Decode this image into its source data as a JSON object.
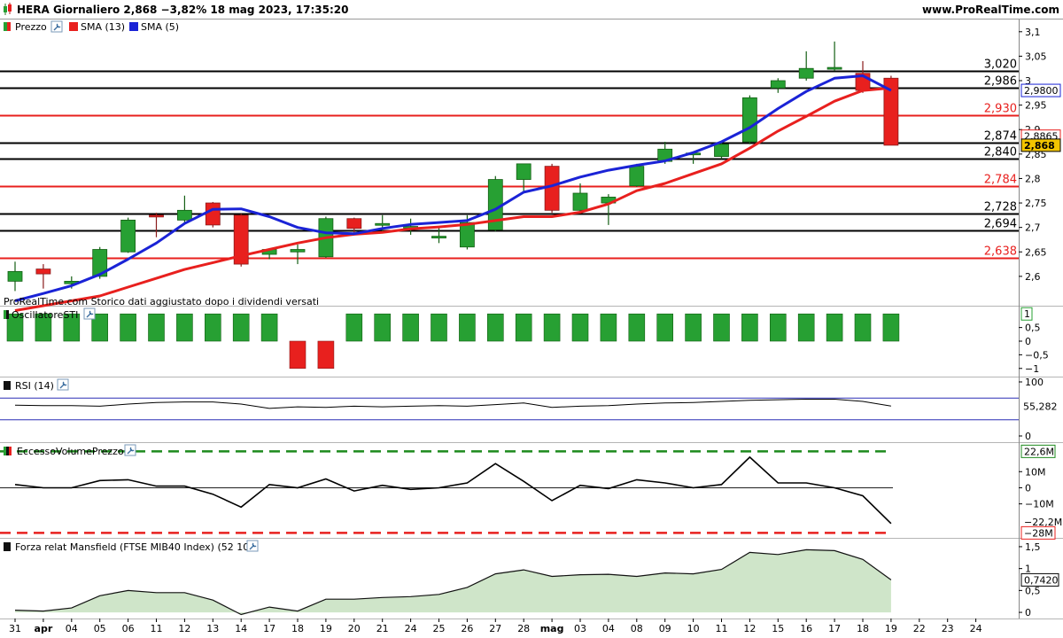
{
  "header": {
    "title": "HERA Giornaliero 2,868 −3,82% 18 mag 2023, 17:35:20",
    "site": "www.ProRealTime.com"
  },
  "note": "ProRealTime.com  Storico dati aggiustato dopo i dividendi versati",
  "colors": {
    "up": "#27a033",
    "down": "#e8201e",
    "sma13": "#e8201e",
    "sma5": "#1a23d6",
    "level_black": "#000000",
    "level_red": "#e8201e",
    "current_badge": "#f2c500",
    "volume_dash_up": "#1d8a1d",
    "volume_dash_down": "#e8201e",
    "mansfield_fill": "#cfe5c9"
  },
  "chart_data": [
    {
      "type": "candlestick",
      "name": "price",
      "legend": [
        {
          "name": "Prezzo",
          "color": "#27a033",
          "icon": "candle-icon"
        },
        {
          "name": "SMA (13)",
          "color": "#e8201e"
        },
        {
          "name": "SMA (5)",
          "color": "#1a23d6"
        }
      ],
      "ylim": [
        2.54,
        3.125
      ],
      "y_ticks": [
        "2,6",
        "2,65",
        "2,7",
        "2,75",
        "2,8",
        "2,85",
        "2,9",
        "2,95",
        "3",
        "3,05",
        "3,1"
      ],
      "y_tick_values": [
        2.6,
        2.65,
        2.7,
        2.75,
        2.8,
        2.85,
        2.9,
        2.95,
        3.0,
        3.05,
        3.1
      ],
      "x_labels": [
        "31",
        "apr",
        "04",
        "05",
        "06",
        "11",
        "12",
        "13",
        "14",
        "17",
        "18",
        "19",
        "20",
        "21",
        "24",
        "25",
        "26",
        "27",
        "28",
        "mag",
        "03",
        "04",
        "08",
        "09",
        "10",
        "11",
        "12",
        "15",
        "16",
        "17",
        "18",
        "19",
        "22",
        "23",
        "24"
      ],
      "bold_x_labels": [
        "apr",
        "mag"
      ],
      "candles": [
        {
          "o": 2.59,
          "h": 2.63,
          "l": 2.57,
          "c": 2.61
        },
        {
          "o": 2.615,
          "h": 2.625,
          "l": 2.575,
          "c": 2.605
        },
        {
          "o": 2.585,
          "h": 2.6,
          "l": 2.575,
          "c": 2.59
        },
        {
          "o": 2.6,
          "h": 2.66,
          "l": 2.595,
          "c": 2.655
        },
        {
          "o": 2.65,
          "h": 2.72,
          "l": 2.648,
          "c": 2.715
        },
        {
          "o": 2.725,
          "h": 2.73,
          "l": 2.68,
          "c": 2.722
        },
        {
          "o": 2.715,
          "h": 2.765,
          "l": 2.71,
          "c": 2.735
        },
        {
          "o": 2.75,
          "h": 2.752,
          "l": 2.7,
          "c": 2.705
        },
        {
          "o": 2.725,
          "h": 2.728,
          "l": 2.62,
          "c": 2.625
        },
        {
          "o": 2.645,
          "h": 2.655,
          "l": 2.635,
          "c": 2.655
        },
        {
          "o": 2.65,
          "h": 2.665,
          "l": 2.625,
          "c": 2.655
        },
        {
          "o": 2.64,
          "h": 2.722,
          "l": 2.638,
          "c": 2.718
        },
        {
          "o": 2.718,
          "h": 2.72,
          "l": 2.685,
          "c": 2.698
        },
        {
          "o": 2.705,
          "h": 2.725,
          "l": 2.69,
          "c": 2.708
        },
        {
          "o": 2.7,
          "h": 2.718,
          "l": 2.685,
          "c": 2.702
        },
        {
          "o": 2.68,
          "h": 2.7,
          "l": 2.668,
          "c": 2.682
        },
        {
          "o": 2.66,
          "h": 2.725,
          "l": 2.655,
          "c": 2.71
        },
        {
          "o": 2.695,
          "h": 2.805,
          "l": 2.692,
          "c": 2.798
        },
        {
          "o": 2.798,
          "h": 2.83,
          "l": 2.77,
          "c": 2.83
        },
        {
          "o": 2.825,
          "h": 2.83,
          "l": 2.73,
          "c": 2.735
        },
        {
          "o": 2.735,
          "h": 2.79,
          "l": 2.73,
          "c": 2.77
        },
        {
          "o": 2.75,
          "h": 2.768,
          "l": 2.705,
          "c": 2.762
        },
        {
          "o": 2.785,
          "h": 2.83,
          "l": 2.783,
          "c": 2.825
        },
        {
          "o": 2.835,
          "h": 2.875,
          "l": 2.83,
          "c": 2.86
        },
        {
          "o": 2.85,
          "h": 2.855,
          "l": 2.83,
          "c": 2.852
        },
        {
          "o": 2.845,
          "h": 2.875,
          "l": 2.84,
          "c": 2.87
        },
        {
          "o": 2.875,
          "h": 2.97,
          "l": 2.87,
          "c": 2.965
        },
        {
          "o": 2.985,
          "h": 3.005,
          "l": 2.975,
          "c": 3.0
        },
        {
          "o": 3.005,
          "h": 3.06,
          "l": 3.0,
          "c": 3.025
        },
        {
          "o": 3.025,
          "h": 3.08,
          "l": 3.02,
          "c": 3.027
        },
        {
          "o": 3.015,
          "h": 3.04,
          "l": 2.975,
          "c": 2.98
        },
        {
          "o": 3.005,
          "h": 3.01,
          "l": 2.868,
          "c": 2.868
        }
      ],
      "sma13": [
        2.53,
        2.54,
        2.55,
        2.56,
        2.578,
        2.596,
        2.614,
        2.628,
        2.642,
        2.655,
        2.668,
        2.679,
        2.686,
        2.69,
        2.697,
        2.701,
        2.706,
        2.714,
        2.722,
        2.722,
        2.731,
        2.748,
        2.775,
        2.79,
        2.81,
        2.83,
        2.862,
        2.897,
        2.927,
        2.958,
        2.98,
        2.985
      ],
      "sma5": [
        2.55,
        2.565,
        2.581,
        2.604,
        2.635,
        2.668,
        2.708,
        2.737,
        2.738,
        2.722,
        2.7,
        2.689,
        2.687,
        2.698,
        2.706,
        2.71,
        2.714,
        2.737,
        2.772,
        2.785,
        2.803,
        2.817,
        2.827,
        2.836,
        2.853,
        2.875,
        2.904,
        2.943,
        2.978,
        3.005,
        3.01,
        2.98
      ],
      "levels": [
        {
          "value": 3.02,
          "label": "3,020",
          "color": "#000000"
        },
        {
          "value": 2.986,
          "label": "2,986",
          "color": "#000000"
        },
        {
          "value": 2.93,
          "label": "2,930",
          "color": "#e8201e"
        },
        {
          "value": 2.874,
          "label": "2,874",
          "color": "#000000"
        },
        {
          "value": 2.84,
          "label": "2,840",
          "color": "#000000"
        },
        {
          "value": 2.784,
          "label": "2,784",
          "color": "#e8201e"
        },
        {
          "value": 2.728,
          "label": "2,728",
          "color": "#000000"
        },
        {
          "value": 2.694,
          "label": "2,694",
          "color": "#000000"
        },
        {
          "value": 2.638,
          "label": "2,638",
          "color": "#e8201e"
        }
      ],
      "badges": [
        {
          "value": 2.98,
          "label": "2,9800",
          "style": "outline-blue"
        },
        {
          "value": 2.8865,
          "label": "2,8865",
          "style": "outline-red"
        },
        {
          "value": 2.868,
          "label": "2,868",
          "style": "fill-yellow"
        }
      ]
    },
    {
      "type": "bar",
      "name": "OscillatoreSTI",
      "legend": "OscillatoreSTI",
      "ylim": [
        -1.3,
        1.3
      ],
      "y_ticks": [
        "1",
        "0,5",
        "0",
        "−0,5",
        "−1"
      ],
      "y_tick_values": [
        1,
        0.5,
        0,
        -0.5,
        -1
      ],
      "values": [
        1,
        1,
        1,
        1,
        1,
        1,
        1,
        1,
        1,
        1,
        -1,
        -1,
        1,
        1,
        1,
        1,
        1,
        1,
        1,
        1,
        1,
        1,
        1,
        1,
        1,
        1,
        1,
        1,
        1,
        1,
        1,
        1
      ],
      "badge": "1"
    },
    {
      "type": "line",
      "name": "RSI (14)",
      "legend": "RSI (14)",
      "ylim": [
        0,
        100
      ],
      "y_ticks": [
        "100",
        "0"
      ],
      "y_tick_values": [
        100,
        0
      ],
      "bands": [
        70,
        30
      ],
      "values": [
        57,
        56,
        56,
        55,
        59,
        62,
        63,
        63,
        59,
        51,
        54,
        53,
        55,
        54,
        55,
        56,
        55,
        58,
        61,
        53,
        55,
        56,
        59,
        61,
        62,
        64,
        66,
        67,
        68,
        68,
        64,
        55.282
      ],
      "badge": "55,282"
    },
    {
      "type": "line",
      "name": "EccessoVolumePrezzo",
      "legend": "EccessoVolumePrezzo",
      "ylim": [
        -30,
        25
      ],
      "y_ticks": [
        "10M",
        "0",
        "−10M"
      ],
      "y_tick_values": [
        10,
        0,
        -10
      ],
      "upper_band": 22.6,
      "lower_band": -28,
      "values": [
        2,
        0,
        0,
        4.5,
        5,
        1,
        1,
        -4,
        -12,
        2,
        0,
        5.5,
        -2,
        1.5,
        -1,
        0,
        3,
        15,
        4,
        -8,
        1.5,
        -0.5,
        5,
        3,
        0,
        2,
        19,
        3,
        3,
        0,
        -5,
        -22.2
      ],
      "badges": [
        {
          "value": 22.6,
          "label": "22,6M",
          "style": "outline-green"
        },
        {
          "value": -22.2,
          "label": "−22,2M",
          "style": "outline-black"
        },
        {
          "value": -28,
          "label": "−28M",
          "style": "outline-red"
        }
      ]
    },
    {
      "type": "area",
      "name": "Forza relat Mansfield (FTSE MIB40 Index) (52 10)",
      "legend": "Forza relat Mansfield (FTSE MIB40 Index) (52 10)",
      "ylim": [
        -0.12,
        1.6
      ],
      "y_ticks": [
        "1,5",
        "1",
        "0,5",
        "0"
      ],
      "y_tick_values": [
        1.5,
        1,
        0.5,
        0
      ],
      "values": [
        0.05,
        0.03,
        0.1,
        0.38,
        0.5,
        0.45,
        0.45,
        0.28,
        -0.05,
        0.12,
        0.03,
        0.3,
        0.3,
        0.34,
        0.36,
        0.41,
        0.57,
        0.88,
        0.97,
        0.82,
        0.86,
        0.87,
        0.82,
        0.9,
        0.88,
        0.98,
        1.37,
        1.32,
        1.43,
        1.41,
        1.21,
        0.742
      ],
      "badge": "0,7420"
    }
  ]
}
